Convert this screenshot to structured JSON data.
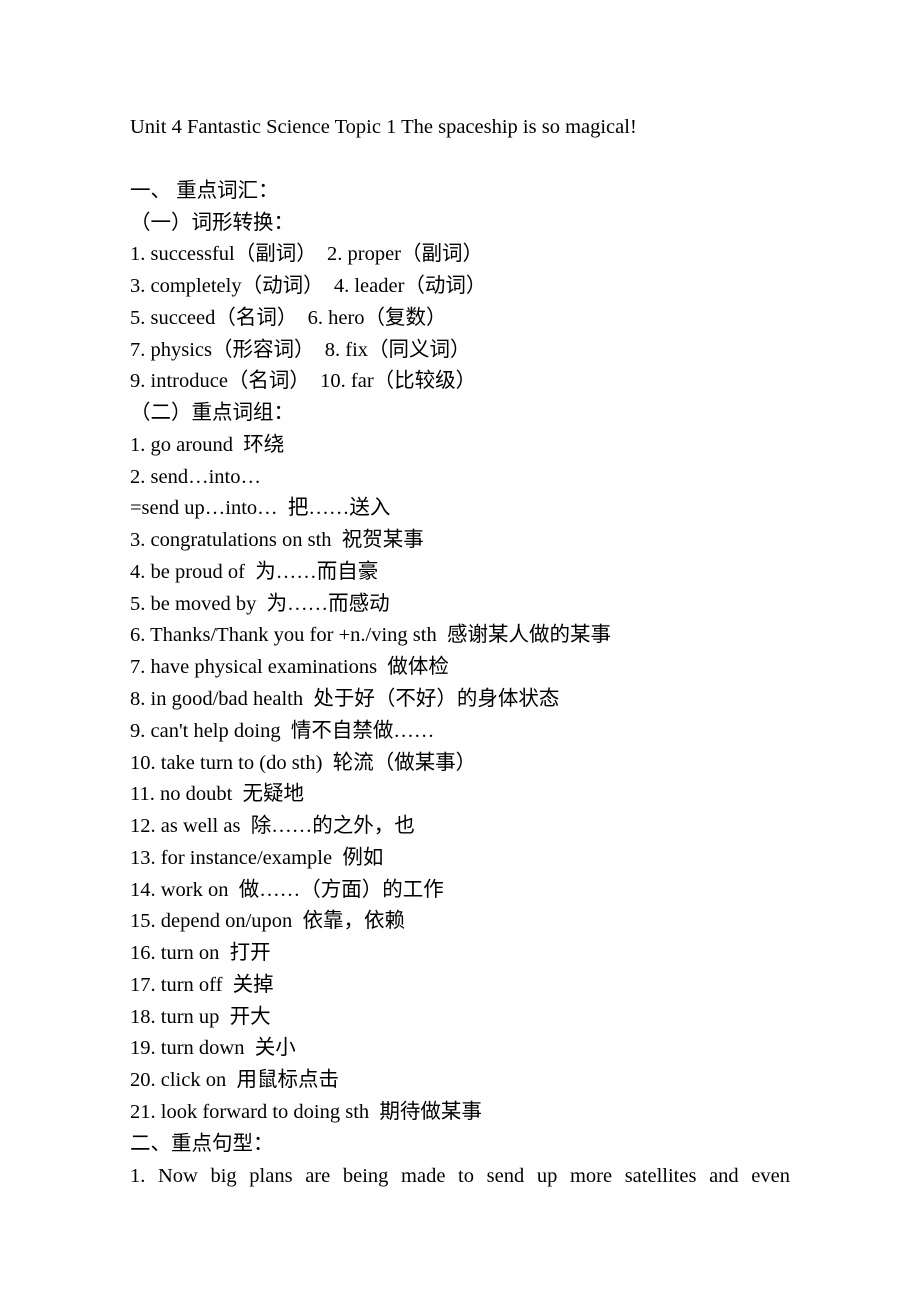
{
  "title": "Unit 4 Fantastic Science Topic 1 The spaceship is so magical!",
  "section1": {
    "heading": "一、 重点词汇：",
    "sub1_heading": "（一）词形转换：",
    "forms": [
      "1. successful（副词）  2. proper（副词）",
      "3. completely（动词）  4. leader（动词）",
      "5. succeed（名词）  6. hero（复数）",
      "7. physics（形容词）  8. fix（同义词）",
      "9. introduce（名词）  10. far（比较级）"
    ],
    "sub2_heading": "（二）重点词组：",
    "phrases": [
      "1. go around  环绕",
      "2. send…into…",
      "=send up…into…  把……送入",
      "3. congratulations on sth  祝贺某事",
      "4. be proud of  为……而自豪",
      "5. be moved by  为……而感动",
      "6. Thanks/Thank you for +n./ving sth  感谢某人做的某事",
      "7. have physical examinations  做体检",
      "8. in good/bad health  处于好（不好）的身体状态",
      "9. can't help doing  情不自禁做……",
      "10. take turn to (do sth)  轮流（做某事）",
      "11. no doubt  无疑地",
      "12. as well as  除……的之外，也",
      "13. for instance/example  例如",
      "14. work on  做……（方面）的工作",
      "15. depend on/upon  依靠，依赖",
      "16. turn on  打开",
      "17. turn off  关掉",
      "18. turn up  开大",
      "19. turn down  关小",
      "20. click on  用鼠标点击",
      "21. look forward to doing sth  期待做某事"
    ]
  },
  "section2": {
    "heading": "二、重点句型：",
    "sentences": [
      "1. Now big plans are being made to send up more satellites and even"
    ]
  }
}
